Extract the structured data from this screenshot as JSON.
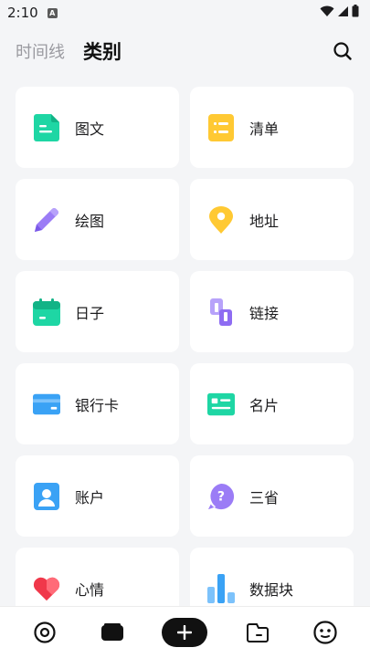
{
  "status_bar": {
    "time": "2:10",
    "badge": "A"
  },
  "header": {
    "tab_timeline": "时间线",
    "tab_category": "类别"
  },
  "categories": [
    {
      "label": "图文",
      "icon": "text-doc-icon",
      "color": "#1ed6a4"
    },
    {
      "label": "清单",
      "icon": "checklist-icon",
      "color": "#ffc933"
    },
    {
      "label": "绘图",
      "icon": "pencil-icon",
      "color": "#9b7cf6"
    },
    {
      "label": "地址",
      "icon": "location-pin-icon",
      "color": "#ffc933"
    },
    {
      "label": "日子",
      "icon": "calendar-icon",
      "color": "#1ed6a4"
    },
    {
      "label": "链接",
      "icon": "link-icon",
      "color": "#9b7cf6"
    },
    {
      "label": "银行卡",
      "icon": "bank-card-icon",
      "color": "#3aa2f5"
    },
    {
      "label": "名片",
      "icon": "business-card-icon",
      "color": "#1ed6a4"
    },
    {
      "label": "账户",
      "icon": "account-icon",
      "color": "#3aa2f5"
    },
    {
      "label": "三省",
      "icon": "question-bubble-icon",
      "color": "#9b7cf6"
    },
    {
      "label": "心情",
      "icon": "heart-icon",
      "color": "#f0384a"
    },
    {
      "label": "数据块",
      "icon": "bar-chart-icon",
      "color": "#3aa2f5"
    }
  ],
  "bottom_nav": [
    {
      "icon": "target-icon"
    },
    {
      "icon": "box-icon"
    },
    {
      "icon": "add-icon"
    },
    {
      "icon": "folder-icon"
    },
    {
      "icon": "face-icon"
    }
  ]
}
